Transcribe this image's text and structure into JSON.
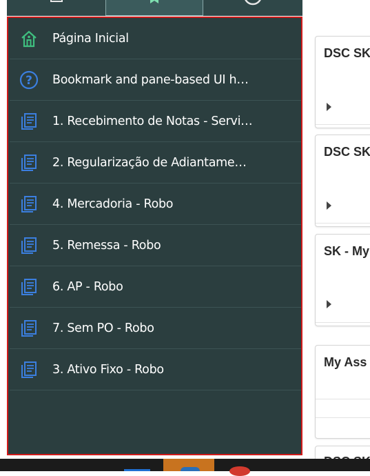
{
  "tabs": [
    {
      "icon": "page-icon"
    },
    {
      "icon": "bookmark-icon"
    },
    {
      "icon": "history-icon"
    }
  ],
  "nav": {
    "items": [
      {
        "label": "Página Inicial",
        "icon": "home-icon"
      },
      {
        "label": "Bookmark and pane-based UI h…",
        "icon": "help-icon"
      },
      {
        "label": "1. Recebimento de Notas - Servi…",
        "icon": "document-icon"
      },
      {
        "label": "2. Regularização de Adiantame…",
        "icon": "document-icon"
      },
      {
        "label": "4. Mercadoria - Robo",
        "icon": "document-icon"
      },
      {
        "label": "5. Remessa - Robo",
        "icon": "document-icon"
      },
      {
        "label": "6. AP - Robo",
        "icon": "document-icon"
      },
      {
        "label": "7. Sem PO - Robo",
        "icon": "document-icon"
      },
      {
        "label": "3. Ativo Fixo - Robo",
        "icon": "document-icon"
      }
    ]
  },
  "cards": [
    {
      "title": "DSC SK"
    },
    {
      "title": "DSC SK"
    },
    {
      "title": "SK - My"
    },
    {
      "title": "My Ass"
    },
    {
      "title": "DSC SK"
    }
  ],
  "colors": {
    "panel_bg": "#2b3e3f",
    "panel_border": "#d11a1a",
    "home_icon": "#3fbf7f",
    "doc_icon": "#3b7fe0"
  }
}
